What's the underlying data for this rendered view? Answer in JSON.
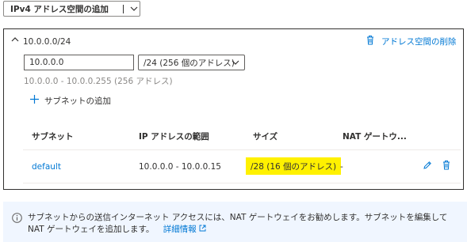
{
  "toolbar": {
    "add_ipv4_label": "IPv4 アドレス空間の追加"
  },
  "address_space": {
    "title": "10.0.0.0/24",
    "delete_label": "アドレス空間の削除",
    "address_value": "10.0.0.0",
    "prefix_selected": "/24 (256 個のアドレス)",
    "range_text": "10.0.0.0 - 10.0.0.255 (256 アドレス)",
    "add_subnet_label": "サブネットの追加"
  },
  "subnet_table": {
    "columns": [
      "サブネット",
      "IP アドレスの範囲",
      "サイズ",
      "NAT ゲートウ..."
    ],
    "rows": [
      {
        "name": "default",
        "range": "10.0.0.0 - 10.0.0.15",
        "size": "/28 (16 個のアドレス)",
        "nat": "-"
      }
    ]
  },
  "info": {
    "text": "サブネットからの送信インターネット アクセスには、NAT ゲートウェイをお勧めします。サブネットを編集して NAT ゲートウェイを追加します。",
    "link_label": "詳細情報"
  },
  "colors": {
    "accent": "#0078d4",
    "highlight": "#fff100",
    "info_bg": "#f0f6ff"
  },
  "icons": [
    "chevron-down-icon",
    "chevron-up-icon",
    "trash-icon",
    "plus-icon",
    "pencil-icon",
    "info-icon",
    "external-link-icon"
  ]
}
